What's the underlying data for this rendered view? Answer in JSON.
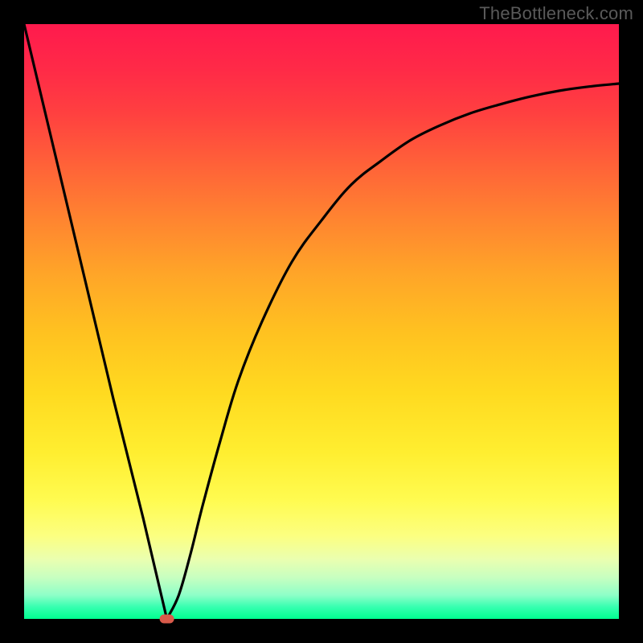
{
  "watermark": "TheBottleneck.com",
  "colors": {
    "frame": "#000000",
    "curve": "#000000",
    "min_marker": "#d85a4a",
    "gradient_top": "#ff1a4d",
    "gradient_bottom": "#00ff90"
  },
  "chart_data": {
    "type": "line",
    "title": "",
    "xlabel": "",
    "ylabel": "",
    "xlim": [
      0,
      100
    ],
    "ylim": [
      0,
      100
    ],
    "axes_visible": false,
    "background": "rainbow-vertical-gradient (red top → green bottom)",
    "series": [
      {
        "name": "bottleneck-curve",
        "x": [
          0,
          5,
          10,
          15,
          20,
          24,
          26,
          28,
          30,
          33,
          36,
          40,
          45,
          50,
          55,
          60,
          65,
          70,
          75,
          80,
          85,
          90,
          95,
          100
        ],
        "values": [
          100,
          79,
          58,
          37,
          17,
          0,
          4,
          11,
          19,
          30,
          40,
          50,
          60,
          67,
          73,
          77,
          80.5,
          83,
          85,
          86.5,
          87.8,
          88.8,
          89.5,
          90
        ]
      }
    ],
    "annotations": [
      {
        "name": "minimum-marker",
        "x": 24,
        "y": 0,
        "shape": "rounded-dot",
        "color": "#d85a4a"
      }
    ]
  }
}
